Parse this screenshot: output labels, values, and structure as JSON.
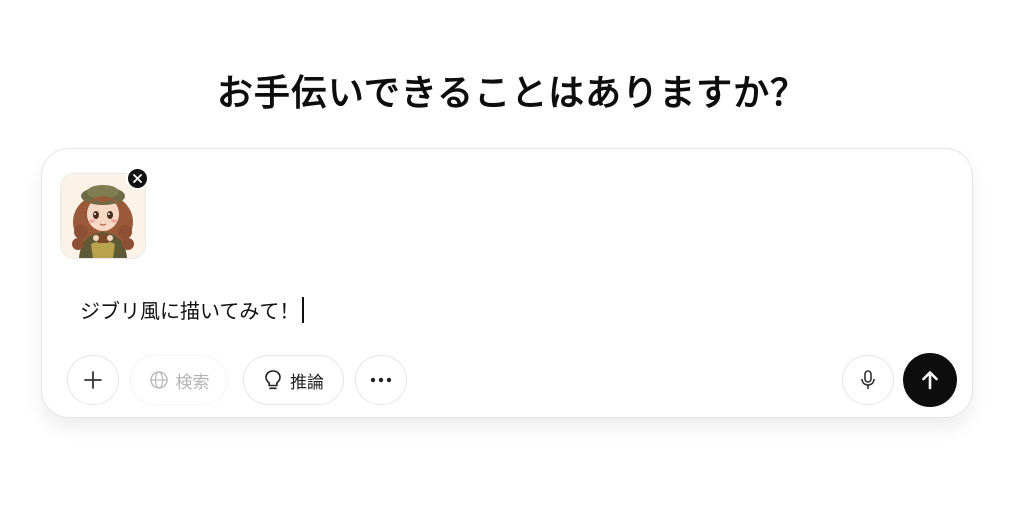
{
  "heading": "お手伝いできることはありますか？",
  "composer": {
    "attachment": {
      "icon": "illustration-thumbnail"
    },
    "remove_icon": "close-icon",
    "input_value": "ジブリ風に描いてみて！",
    "toolbar": {
      "add_icon": "plus-icon",
      "search_label": "検索",
      "search_icon": "globe-icon",
      "reason_label": "推論",
      "reason_icon": "lightbulb-icon",
      "more_icon": "ellipsis-icon",
      "mic_icon": "microphone-icon",
      "send_icon": "arrow-up-icon"
    }
  },
  "colors": {
    "send_button": "#0d0d0d",
    "disabled_text": "#b3b3b3",
    "border": "#e5e5e5"
  }
}
